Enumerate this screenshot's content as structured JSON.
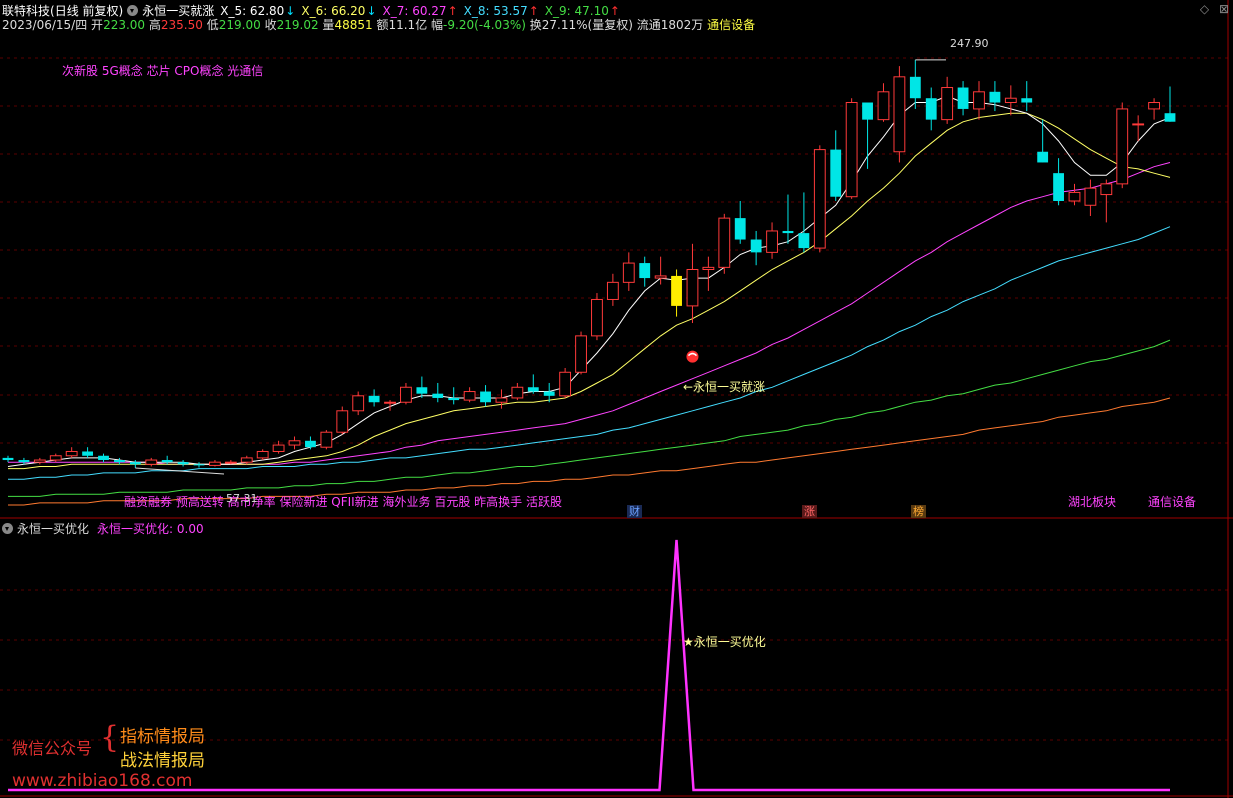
{
  "header": {
    "stock_name": "联特科技",
    "period": "(日线 前复权)",
    "indicator": "永恒一买就涨",
    "ma": [
      {
        "label": "X_5: 62.80",
        "arrow": "↓",
        "color": "#ffffff",
        "arrow_color": "#00e0ff"
      },
      {
        "label": "X_6: 66.20",
        "arrow": "↓",
        "color": "#ffff66",
        "arrow_color": "#00e0ff"
      },
      {
        "label": "X_7: 60.27",
        "arrow": "↑",
        "color": "#ff44ff",
        "arrow_color": "#ff3030"
      },
      {
        "label": "X_8: 53.57",
        "arrow": "↑",
        "color": "#44ddff",
        "arrow_color": "#ff3030"
      },
      {
        "label": "X_9: 47.10",
        "arrow": "↑",
        "color": "#44dd44",
        "arrow_color": "#ff3030"
      }
    ]
  },
  "quote": {
    "date": "2023/06/15/四",
    "open_label": "开",
    "open": "223.00",
    "high_label": "高",
    "high": "235.50",
    "low_label": "低",
    "low": "219.00",
    "close_label": "收",
    "close": "219.02",
    "vol_label": "量",
    "vol": "48851",
    "amt_label": "额",
    "amt": "11.1亿",
    "chg_label": "幅",
    "chg": "-9.20(-4.03%)",
    "turn_label": "换",
    "turn": "27.11%(量复权)",
    "float_label": "流通",
    "float": "1802万",
    "sector": "通信设备"
  },
  "colors": {
    "up": "#ff3a3a",
    "down": "#00e6e6",
    "signal": "#ffee00",
    "ma5": "#ffffff",
    "ma6": "#ffff66",
    "ma7": "#ff44ff",
    "ma8": "#44ddff",
    "ma9": "#44dd44",
    "ma10": "#ff7a30",
    "sub": "#ff33ff",
    "concept": "#ff44ff",
    "grid": "#5a0000"
  },
  "concepts_top": "次新股 5G概念 芯片 CPO概念 光通信",
  "concepts_bottom": "融资融券 预高送转 高市净率 保险新进 QFII新进 海外业务 百元股 昨高换手 活跃股",
  "sector_tags": {
    "region": "湖北板块",
    "industry": "通信设备"
  },
  "event_tags": [
    {
      "text": "财",
      "color": "#6aa0ff",
      "bg": "#1a2a55"
    },
    {
      "text": "涨",
      "color": "#ff6666",
      "bg": "#5a1a1a"
    },
    {
      "text": "榜",
      "color": "#ffaa33",
      "bg": "#5a3a10"
    }
  ],
  "annotations": {
    "max_price": "247.90",
    "min_price": "57.31",
    "signal": "←永恒一买就涨"
  },
  "icons": {
    "top_right": [
      "diamond-icon",
      "close-icon"
    ],
    "header_toggle": "circle-dropdown-icon"
  },
  "sub": {
    "title": "永恒一买优化",
    "value_label": "永恒一买优化: 0.00",
    "peak_label": "★永恒一买优化",
    "peak_value": 1
  },
  "watermark": {
    "public": "微信公众号",
    "brand1": "指标情报局",
    "brand2": "战法情报局",
    "url": "www.zhibiao168.com"
  },
  "chart_data": {
    "type": "candlestick",
    "ylim": [
      40,
      260
    ],
    "candles": [
      [
        62,
        63,
        60,
        61
      ],
      [
        61,
        62,
        59,
        60
      ],
      [
        60,
        62,
        59,
        61
      ],
      [
        61,
        64,
        60,
        63
      ],
      [
        63,
        67,
        62,
        65
      ],
      [
        65,
        67,
        62,
        63
      ],
      [
        63,
        64,
        60,
        61
      ],
      [
        61,
        62,
        59,
        60
      ],
      [
        60,
        61,
        57.31,
        59
      ],
      [
        59,
        62,
        58,
        61
      ],
      [
        61,
        63,
        59,
        60
      ],
      [
        60,
        61,
        58,
        59
      ],
      [
        59,
        60,
        57.5,
        58.5
      ],
      [
        58.5,
        61,
        58,
        60
      ],
      [
        60,
        61,
        59,
        60
      ],
      [
        60,
        63,
        59,
        62
      ],
      [
        62,
        66,
        61,
        65
      ],
      [
        65,
        70,
        64,
        68
      ],
      [
        68,
        72,
        66,
        70
      ],
      [
        70,
        72,
        66,
        67
      ],
      [
        67,
        75,
        66,
        74
      ],
      [
        74,
        86,
        73,
        84
      ],
      [
        84,
        93,
        82,
        91
      ],
      [
        91,
        94,
        86,
        88
      ],
      [
        88,
        89,
        84,
        88
      ],
      [
        88,
        97,
        87,
        95
      ],
      [
        95,
        100,
        90,
        92
      ],
      [
        92,
        97,
        88,
        90
      ],
      [
        90,
        95,
        87,
        89
      ],
      [
        89,
        95,
        88,
        93
      ],
      [
        93,
        96,
        86,
        88
      ],
      [
        88,
        94,
        85,
        90
      ],
      [
        90,
        97,
        89,
        95
      ],
      [
        95,
        101,
        92,
        93
      ],
      [
        93,
        97,
        88,
        91
      ],
      [
        91,
        104,
        90,
        102
      ],
      [
        102,
        121,
        101,
        119
      ],
      [
        119,
        139,
        117,
        136
      ],
      [
        136,
        148,
        133,
        144
      ],
      [
        144,
        158,
        140,
        153
      ],
      [
        153,
        156,
        142,
        146
      ],
      [
        146,
        156,
        143,
        147
      ],
      [
        147,
        150,
        128,
        133
      ],
      [
        133,
        162,
        125,
        150
      ],
      [
        150,
        156,
        140,
        151
      ],
      [
        151,
        176,
        148,
        174
      ],
      [
        174,
        182,
        162,
        164
      ],
      [
        164,
        168,
        152,
        158
      ],
      [
        158,
        172,
        155,
        168
      ],
      [
        168,
        185,
        162,
        167
      ],
      [
        167,
        186,
        158,
        160
      ],
      [
        160,
        208,
        158,
        206
      ],
      [
        206,
        215,
        182,
        184
      ],
      [
        184,
        230,
        183,
        228
      ],
      [
        228,
        224,
        197,
        220
      ],
      [
        220,
        237,
        219,
        233
      ],
      [
        205,
        245,
        200,
        240
      ],
      [
        240,
        247.9,
        225,
        230
      ],
      [
        230,
        235,
        215,
        220
      ],
      [
        220,
        240,
        218,
        235
      ],
      [
        235,
        238,
        222,
        225
      ],
      [
        225,
        238,
        220,
        233
      ],
      [
        233,
        238,
        224,
        228
      ],
      [
        228,
        236,
        222,
        230
      ],
      [
        230,
        238,
        224,
        228
      ],
      [
        205,
        220,
        200,
        200
      ],
      [
        195,
        202,
        180,
        182
      ],
      [
        182,
        190,
        180,
        186
      ],
      [
        180,
        192,
        175,
        188
      ],
      [
        185,
        192,
        172,
        190
      ],
      [
        190,
        228,
        188,
        225
      ],
      [
        218,
        222,
        210,
        218
      ],
      [
        225,
        230,
        220,
        228
      ],
      [
        223,
        235.5,
        219,
        219.02
      ]
    ],
    "signal_index": 42,
    "ma5": [
      58,
      59,
      60,
      61,
      62,
      62,
      62,
      61,
      60,
      60,
      60,
      60,
      59,
      59,
      59,
      60,
      61,
      62,
      65,
      67,
      69,
      73,
      78,
      83,
      86,
      89,
      91,
      91,
      90,
      90,
      90,
      90,
      92,
      93,
      93,
      95,
      103,
      111,
      120,
      131,
      140,
      146,
      145,
      146,
      146,
      151,
      157,
      160,
      161,
      163,
      168,
      174,
      180,
      191,
      203,
      212,
      222,
      228,
      228,
      231,
      228,
      228,
      227,
      225,
      223,
      218,
      210,
      200,
      194,
      194,
      200,
      210,
      218,
      221
    ],
    "ma6": [
      57,
      57,
      58,
      58,
      59,
      59,
      59,
      59,
      59,
      59,
      59,
      59,
      59,
      59,
      59,
      59,
      59,
      60,
      61,
      62,
      63,
      65,
      68,
      72,
      75,
      78,
      80,
      82,
      84,
      85,
      86,
      87,
      88,
      88,
      89,
      90,
      93,
      97,
      101,
      107,
      113,
      119,
      124,
      127,
      131,
      135,
      140,
      145,
      150,
      154,
      158,
      163,
      169,
      175,
      182,
      188,
      195,
      203,
      209,
      215,
      219,
      221,
      222,
      223,
      223,
      220,
      216,
      211,
      206,
      202,
      198,
      197,
      195,
      193
    ],
    "ma7": [
      60,
      60,
      60,
      60,
      60,
      60,
      60,
      60,
      60,
      60,
      59,
      59,
      59,
      59,
      59,
      59,
      59,
      59,
      60,
      60,
      61,
      62,
      63,
      64,
      65,
      67,
      68,
      70,
      71,
      72,
      73,
      74,
      75,
      76,
      77,
      78,
      80,
      82,
      84,
      87,
      90,
      93,
      96,
      99,
      102,
      105,
      108,
      111,
      115,
      118,
      122,
      126,
      130,
      134,
      139,
      144,
      149,
      154,
      158,
      163,
      167,
      171,
      175,
      179,
      182,
      184,
      186,
      187,
      188,
      190,
      192,
      195,
      198,
      200
    ],
    "ma8": [
      52,
      52,
      53,
      53,
      54,
      54,
      55,
      55,
      55,
      56,
      56,
      56,
      57,
      57,
      57,
      57,
      58,
      58,
      58,
      59,
      59,
      60,
      60,
      61,
      62,
      62,
      63,
      64,
      65,
      66,
      66,
      67,
      68,
      69,
      70,
      71,
      72,
      73,
      75,
      76,
      78,
      80,
      82,
      84,
      86,
      88,
      90,
      93,
      95,
      98,
      101,
      104,
      107,
      110,
      114,
      117,
      121,
      124,
      128,
      131,
      135,
      138,
      141,
      145,
      148,
      151,
      154,
      156,
      158,
      160,
      162,
      164,
      167,
      170
    ],
    "ma9": [
      44,
      44,
      44,
      45,
      45,
      45,
      45,
      46,
      46,
      46,
      46,
      47,
      47,
      47,
      47,
      48,
      48,
      48,
      49,
      49,
      50,
      50,
      51,
      51,
      52,
      53,
      53,
      54,
      55,
      55,
      56,
      57,
      58,
      58,
      59,
      60,
      61,
      62,
      63,
      64,
      65,
      66,
      67,
      68,
      69,
      70,
      72,
      73,
      74,
      75,
      77,
      78,
      80,
      81,
      83,
      84,
      86,
      88,
      89,
      91,
      92,
      94,
      96,
      97,
      99,
      101,
      103,
      105,
      107,
      108,
      110,
      112,
      114,
      117
    ],
    "ma10": [
      40,
      40,
      41,
      41,
      41,
      41,
      42,
      42,
      42,
      42,
      42,
      43,
      43,
      43,
      43,
      43,
      44,
      44,
      44,
      44,
      45,
      45,
      46,
      46,
      46,
      47,
      47,
      48,
      48,
      49,
      49,
      50,
      50,
      51,
      51,
      52,
      52,
      53,
      54,
      54,
      55,
      56,
      56,
      57,
      58,
      59,
      60,
      60,
      61,
      62,
      63,
      64,
      65,
      66,
      67,
      68,
      69,
      70,
      71,
      72,
      73,
      75,
      76,
      77,
      78,
      79,
      81,
      82,
      83,
      84,
      86,
      87,
      88,
      90
    ]
  }
}
